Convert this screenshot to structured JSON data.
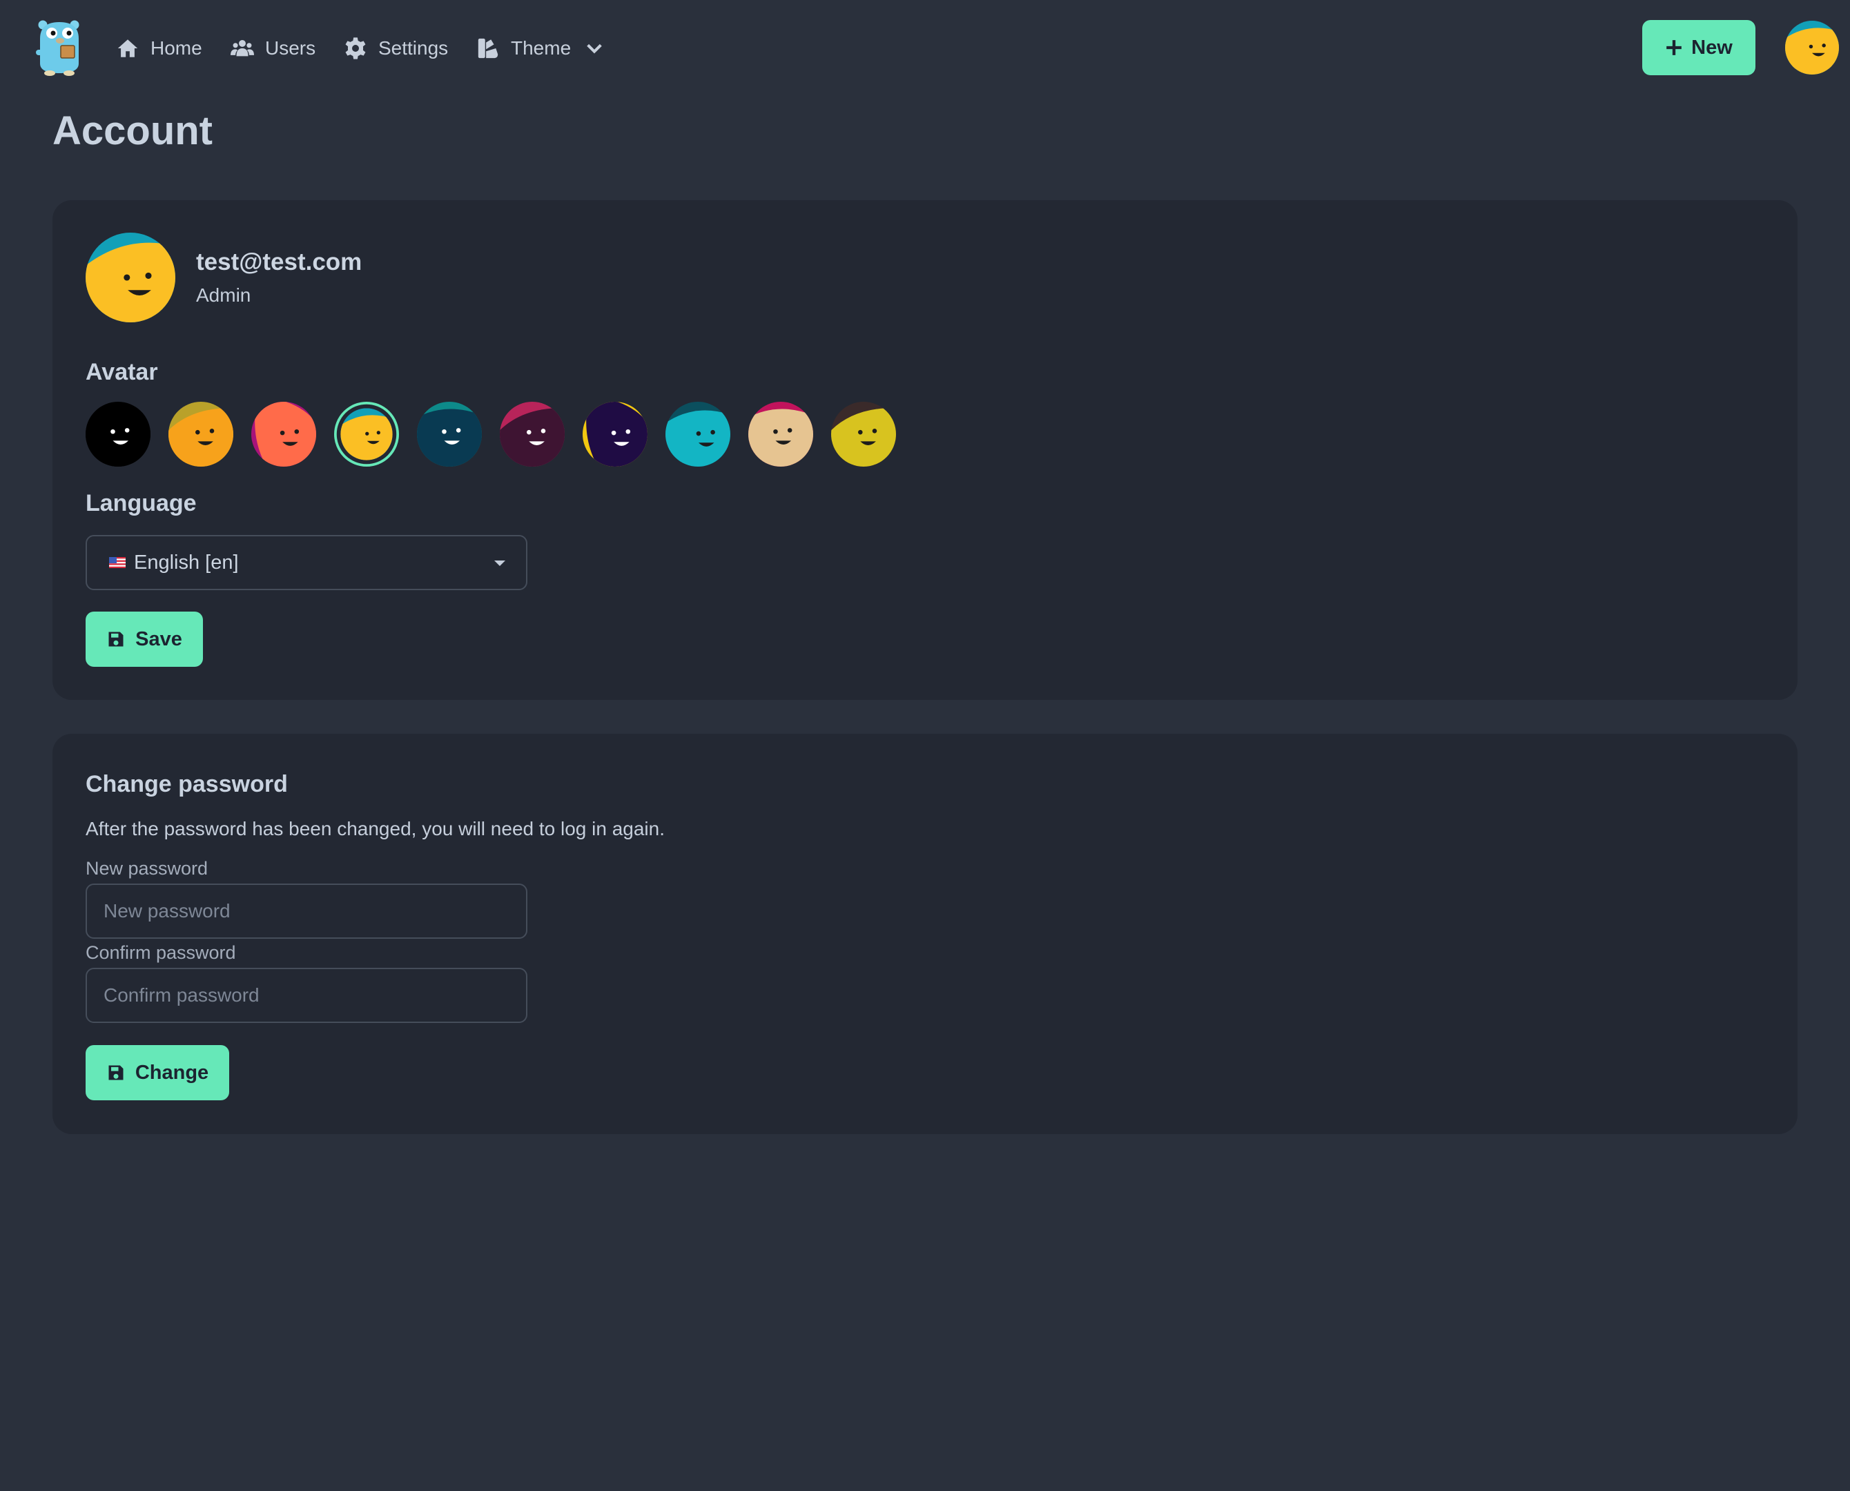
{
  "nav": {
    "home": "Home",
    "users": "Users",
    "settings": "Settings",
    "theme": "Theme",
    "new_button": "New"
  },
  "page": {
    "title": "Account"
  },
  "profile": {
    "email": "test@test.com",
    "role": "Admin"
  },
  "avatar_section": {
    "label": "Avatar",
    "selected_index": 3,
    "options": [
      {
        "name": "avatar-option-black",
        "bg": "#000000",
        "fg": "#000000",
        "face": "#ffffff"
      },
      {
        "name": "avatar-option-orange",
        "bg": "#b9a12a",
        "fg": "#f7a21b",
        "face": "#1c1c1c"
      },
      {
        "name": "avatar-option-coral",
        "bg": "#a8137a",
        "fg": "#ff6b4a",
        "face": "#1c1c1c"
      },
      {
        "name": "avatar-option-yellow",
        "bg": "#12a0b8",
        "fg": "#fbbf24",
        "face": "#1c1c1c"
      },
      {
        "name": "avatar-option-teal",
        "bg": "#0d8a8a",
        "fg": "#093a52",
        "face": "#ffffff"
      },
      {
        "name": "avatar-option-plum",
        "bg": "#b8245a",
        "fg": "#3e1432",
        "face": "#ffffff"
      },
      {
        "name": "avatar-option-indigo",
        "bg": "#f2c811",
        "fg": "#1f0c44",
        "face": "#ffffff"
      },
      {
        "name": "avatar-option-cyan",
        "bg": "#0b4f5e",
        "fg": "#13b5c4",
        "face": "#1c1c1c"
      },
      {
        "name": "avatar-option-beige",
        "bg": "#c2135c",
        "fg": "#e6c491",
        "face": "#1c1c1c"
      },
      {
        "name": "avatar-option-olive",
        "bg": "#3a2a2a",
        "fg": "#d8c31f",
        "face": "#1c1c1c"
      }
    ]
  },
  "language": {
    "label": "Language",
    "selected": "English [en]"
  },
  "account_actions": {
    "save_label": "Save"
  },
  "password": {
    "title": "Change password",
    "description": "After the password has been changed, you will need to log in again.",
    "new_label": "New password",
    "new_placeholder": "New password",
    "confirm_label": "Confirm password",
    "confirm_placeholder": "Confirm password",
    "change_label": "Change"
  },
  "colors": {
    "background": "#2a303c",
    "card": "#232833",
    "accent": "#66e8b8",
    "text": "#c5cedb"
  }
}
